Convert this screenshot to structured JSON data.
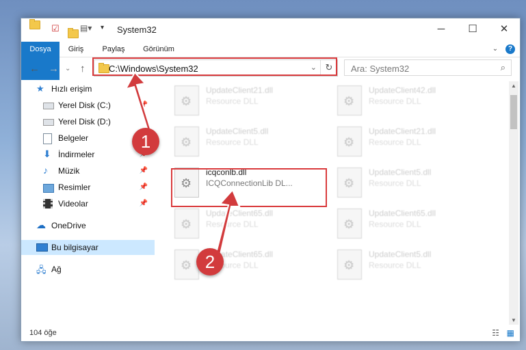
{
  "window": {
    "title": "System32",
    "controls": {
      "minimize": "─",
      "maximize": "☐",
      "close": "✕"
    }
  },
  "ribbon": {
    "tabs": [
      "Dosya",
      "Giriş",
      "Paylaş",
      "Görünüm"
    ]
  },
  "address": {
    "path": "C:\\Windows\\System32",
    "search_placeholder": "Ara: System32"
  },
  "sidebar": {
    "items": [
      {
        "label": "Hızlı erişim",
        "icon": "star-icon",
        "pinned": false
      },
      {
        "label": "Yerel Disk (C:)",
        "icon": "drive-icon",
        "pinned": true
      },
      {
        "label": "Yerel Disk (D:)",
        "icon": "drive-icon",
        "pinned": false
      },
      {
        "label": "Belgeler",
        "icon": "documents-icon",
        "pinned": true
      },
      {
        "label": "İndirmeler",
        "icon": "download-icon",
        "pinned": true
      },
      {
        "label": "Müzik",
        "icon": "music-icon",
        "pinned": true
      },
      {
        "label": "Resimler",
        "icon": "pictures-icon",
        "pinned": true
      },
      {
        "label": "Videolar",
        "icon": "videos-icon",
        "pinned": true
      },
      {
        "label": "OneDrive",
        "icon": "cloud-icon",
        "pinned": false
      },
      {
        "label": "Bu bilgisayar",
        "icon": "computer-icon",
        "pinned": false
      },
      {
        "label": "Ağ",
        "icon": "network-icon",
        "pinned": false
      }
    ]
  },
  "files": [
    {
      "name": "UpdateClient21.dll",
      "desc": "Resource DLL"
    },
    {
      "name": "UpdateClient42.dll",
      "desc": "Resource DLL"
    },
    {
      "name": "UpdateClient5.dll",
      "desc": "Resource DLL"
    },
    {
      "name": "UpdateClient21.dll",
      "desc": "Resource DLL"
    },
    {
      "name": "icqconlb.dll",
      "desc": "ICQConnectionLib DL..."
    },
    {
      "name": "UpdateClient5.dll",
      "desc": "Resource DLL"
    },
    {
      "name": "UpdateClient65.dll",
      "desc": "Resource DLL"
    },
    {
      "name": "UpdateClient65.dll",
      "desc": "Resource DLL"
    },
    {
      "name": "UpdateClient65.dll",
      "desc": "Resource DLL"
    },
    {
      "name": "UpdateClient5.dll",
      "desc": "Resource DLL"
    }
  ],
  "status": {
    "item_count": "104 öğe"
  },
  "annotations": {
    "step1": "1",
    "step2": "2",
    "color": "#d23b3d"
  }
}
